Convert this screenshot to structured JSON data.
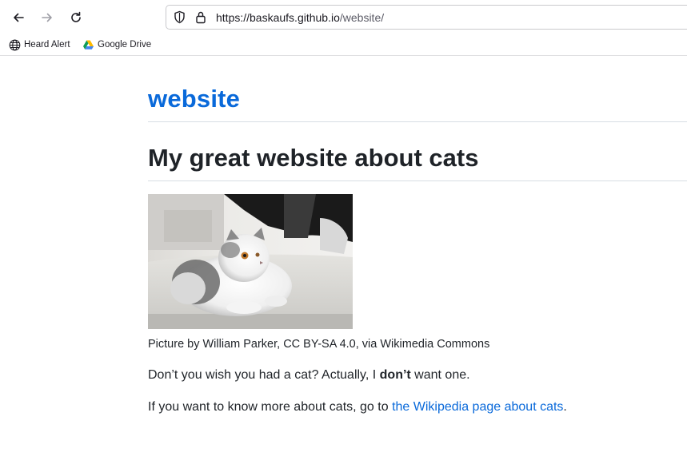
{
  "browser": {
    "url_host": "https://baskaufs.github.io",
    "url_path": "/website/",
    "bookmarks": [
      {
        "label": "Heard Alert",
        "icon": "globe-icon"
      },
      {
        "label": "Google Drive",
        "icon": "google-drive-icon"
      }
    ],
    "icons": {
      "back": "back-arrow-icon",
      "forward": "forward-arrow-icon",
      "reload": "reload-icon",
      "tracking": "shield-icon",
      "security": "lock-icon"
    }
  },
  "page": {
    "site_title": "website",
    "heading": "My great website about cats",
    "photo_alt": "cat-photo",
    "caption": "Picture by William Parker, CC BY-SA 4.0, via Wikimedia Commons",
    "para1_before": "Don’t you wish you had a cat? Actually, I ",
    "para1_bold": "don’t",
    "para1_after": " want one.",
    "para2_before": "If you want to know more about cats, go to ",
    "para2_link": "the Wikipedia page about cats",
    "para2_after": "."
  },
  "colors": {
    "link": "#0969da",
    "text": "#1f2328",
    "rule": "#d8dee4"
  }
}
